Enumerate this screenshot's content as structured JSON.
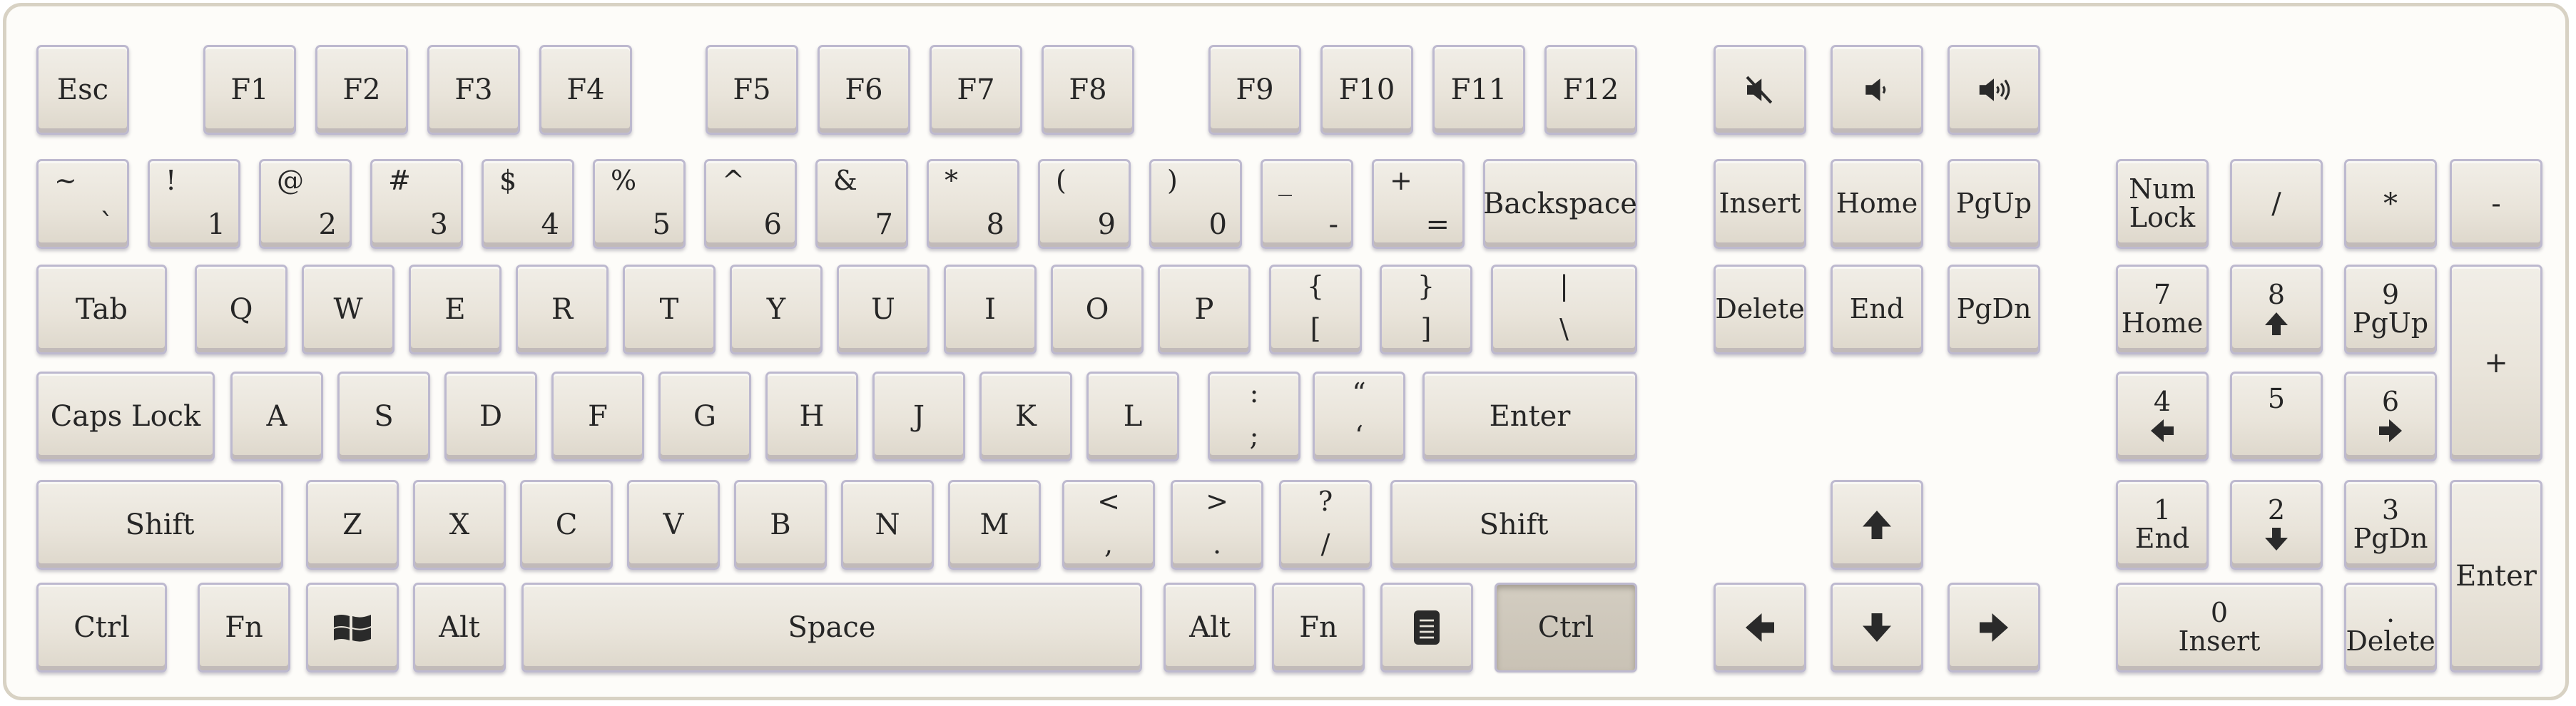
{
  "function_row": {
    "esc": "Esc",
    "f1": "F1",
    "f2": "F2",
    "f3": "F3",
    "f4": "F4",
    "f5": "F5",
    "f6": "F6",
    "f7": "F7",
    "f8": "F8",
    "f9": "F9",
    "f10": "F10",
    "f11": "F11",
    "f12": "F12"
  },
  "media_keys": {
    "mute_icon": "speaker-mute-icon",
    "volume_down_icon": "speaker-low-icon",
    "volume_up_icon": "speaker-high-icon"
  },
  "number_row": [
    {
      "top": "~",
      "bottom": "`"
    },
    {
      "top": "!",
      "bottom": "1"
    },
    {
      "top": "@",
      "bottom": "2"
    },
    {
      "top": "#",
      "bottom": "3"
    },
    {
      "top": "$",
      "bottom": "4"
    },
    {
      "top": "%",
      "bottom": "5"
    },
    {
      "top": "^",
      "bottom": "6"
    },
    {
      "top": "&",
      "bottom": "7"
    },
    {
      "top": "*",
      "bottom": "8"
    },
    {
      "top": "(",
      "bottom": "9"
    },
    {
      "top": ")",
      "bottom": "0"
    },
    {
      "top": "_",
      "bottom": "-"
    },
    {
      "top": "+",
      "bottom": "="
    }
  ],
  "backspace": "Backspace",
  "tab": "Tab",
  "qwerty_row": [
    "Q",
    "W",
    "E",
    "R",
    "T",
    "Y",
    "U",
    "I",
    "O",
    "P"
  ],
  "bracket_keys": [
    {
      "top": "{",
      "bottom": "["
    },
    {
      "top": "}",
      "bottom": "]"
    },
    {
      "top": "|",
      "bottom": "\\"
    }
  ],
  "caps_lock": "Caps Lock",
  "home_row": [
    "A",
    "S",
    "D",
    "F",
    "G",
    "H",
    "J",
    "K",
    "L"
  ],
  "semicolon_keys": [
    {
      "top": ":",
      "bottom": ";"
    },
    {
      "top": "“",
      "bottom": "‘"
    }
  ],
  "enter": "Enter",
  "shift_left": "Shift",
  "bottom_letter_row": [
    "Z",
    "X",
    "C",
    "V",
    "B",
    "N",
    "M"
  ],
  "punct_keys": [
    {
      "top": "<",
      "bottom": ","
    },
    {
      "top": ">",
      "bottom": "."
    },
    {
      "top": "?",
      "bottom": "/"
    }
  ],
  "shift_right": "Shift",
  "ctrl_left": "Ctrl",
  "fn_left": "Fn",
  "windows_icon": "windows-logo-icon",
  "alt_left": "Alt",
  "space": "Space",
  "alt_right": "Alt",
  "fn_right": "Fn",
  "menu_icon": "context-menu-icon",
  "ctrl_right": "Ctrl",
  "nav_cluster": {
    "insert": "Insert",
    "home": "Home",
    "pgup": "PgUp",
    "delete": "Delete",
    "end": "End",
    "pgdn": "PgDn"
  },
  "arrows": {
    "up_icon": "arrow-up-icon",
    "left_icon": "arrow-left-icon",
    "down_icon": "arrow-down-icon",
    "right_icon": "arrow-right-icon"
  },
  "numpad": {
    "numlock_line1": "Num",
    "numlock_line2": "Lock",
    "divide": "/",
    "multiply": "*",
    "minus": "-",
    "plus": "+",
    "n7": "7",
    "n7_sub": "Home",
    "n8": "8",
    "n9": "9",
    "n9_sub": "PgUp",
    "n4": "4",
    "n5": "5",
    "n6": "6",
    "n1": "1",
    "n1_sub": "End",
    "n2": "2",
    "n3": "3",
    "n3_sub": "PgDn",
    "n0": "0",
    "n0_sub": "Insert",
    "dot": ".",
    "dot_sub": "Delete",
    "enter": "Enter"
  },
  "colors": {
    "key_face": "#ebe7de",
    "key_border": "#bdb9cf",
    "pressed_key": "#cdc6b9",
    "legend": "#262626",
    "frame": "#d8d2c4"
  }
}
